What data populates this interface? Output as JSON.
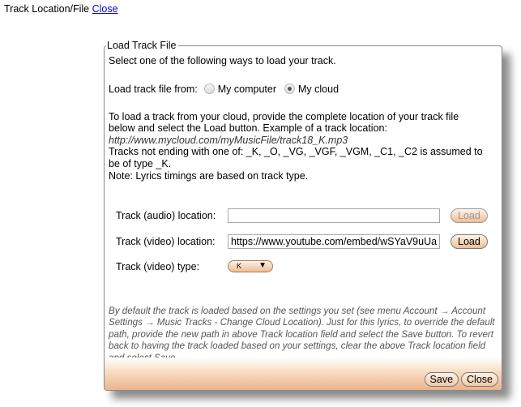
{
  "header": {
    "title": "Track Location/File",
    "close_link": "Close"
  },
  "panel": {
    "legend": "Load Track File",
    "intro": "Select one of the following ways to load your track.",
    "load_from": {
      "label": "Load track file from:",
      "options": [
        {
          "label": "My computer",
          "checked": false
        },
        {
          "label": "My cloud",
          "checked": true
        }
      ]
    },
    "info": {
      "line1": "To load a track from your cloud, provide the complete location of your track file",
      "line2": "below and select the Load button. Example of a track location:",
      "example": "http://www.mycloud.com/myMusicFile/track18_K.mp3",
      "line3": "Tracks not ending with one of: _K, _O, _VG, _VGF, _VGM, _C1, _C2 is assumed to",
      "line4": "be of type _K.",
      "line5": "Note: Lyrics timings are based on track type."
    },
    "audio": {
      "label": "Track (audio) location:",
      "value": "",
      "load_label": "Load"
    },
    "video": {
      "label": "Track (video) location:",
      "value": "https://www.youtube.com/embed/wSYaV9uUa",
      "load_label": "Load"
    },
    "video_type": {
      "label": "Track (video) type:",
      "selected": "K"
    },
    "note": "By default the track is loaded based on the settings you set (see menu Account → Account Settings → Music Tracks - Change Cloud Location). Just for this lyrics, to override the default path, provide the new path in above Track location field and select the Save button. To revert back to having the track loaded based on your settings, clear the above Track location field and select Save.",
    "footer": {
      "save_label": "Save",
      "close_label": "Close"
    }
  },
  "colors": {
    "button_gradient_end": "#efbd94",
    "link": "#0000ee"
  }
}
